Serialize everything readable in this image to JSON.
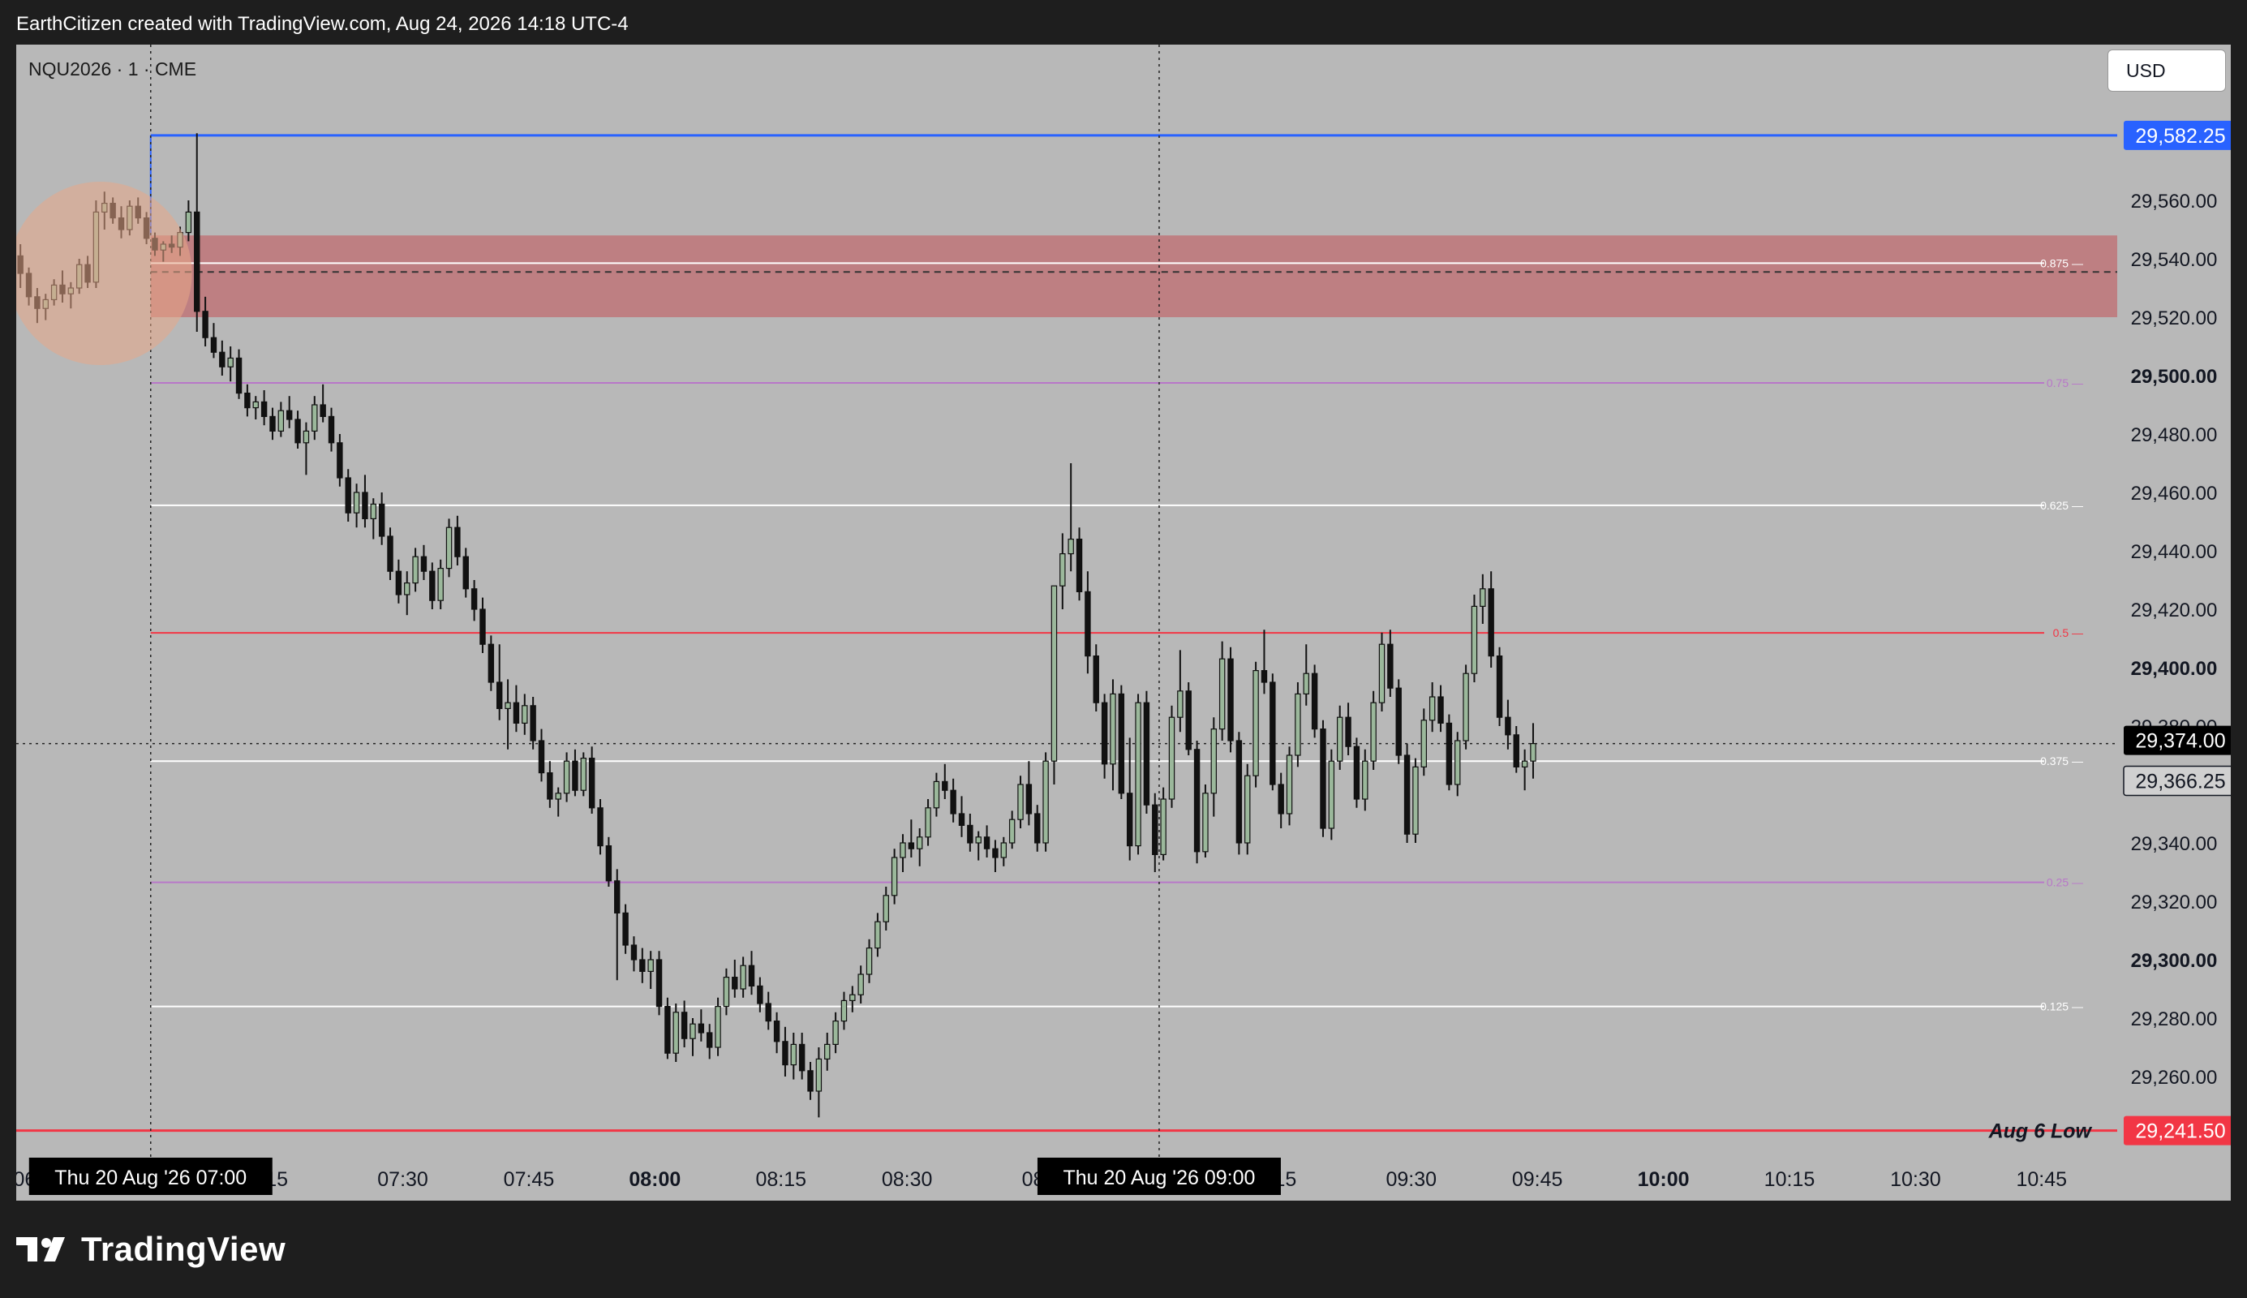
{
  "header": {
    "title": "EarthCitizen created with TradingView.com, Aug 24, 2026 14:18 UTC-4"
  },
  "symbol_label": "NQU2026 · 1 · CME",
  "currency_label": "USD",
  "footer": {
    "brand": "TradingView",
    "logo_icon": "tradingview-logo-icon"
  },
  "colors": {
    "background": "#1e1e1e",
    "plot_bg": "#b8b8b8",
    "up_candle": "#9bb89b",
    "down_candle": "#111111",
    "blue_line": "#2962ff",
    "red_line": "#f23645",
    "purple_line": "#b877c8",
    "white_line": "#ffffff",
    "zone": "#c06a6e"
  },
  "chart_data": {
    "type": "candlestick",
    "title": "NQU2026 · 1 · CME",
    "xlabel": "",
    "ylabel": "",
    "ylim": [
      29230,
      29600
    ],
    "x_range": [
      "06:44",
      "10:54"
    ],
    "yticks": [
      {
        "label": "29,560.00",
        "value": 29560,
        "bold": false
      },
      {
        "label": "29,540.00",
        "value": 29540,
        "bold": false
      },
      {
        "label": "29,520.00",
        "value": 29520,
        "bold": false
      },
      {
        "label": "29,500.00",
        "value": 29500,
        "bold": true
      },
      {
        "label": "29,480.00",
        "value": 29480,
        "bold": false
      },
      {
        "label": "29,460.00",
        "value": 29460,
        "bold": false
      },
      {
        "label": "29,440.00",
        "value": 29440,
        "bold": false
      },
      {
        "label": "29,420.00",
        "value": 29420,
        "bold": false
      },
      {
        "label": "29,400.00",
        "value": 29400,
        "bold": true
      },
      {
        "label": "29,380.00",
        "value": 29380,
        "bold": false
      },
      {
        "label": "29,360.00",
        "value": 29360,
        "bold": false
      },
      {
        "label": "29,340.00",
        "value": 29340,
        "bold": false
      },
      {
        "label": "29,320.00",
        "value": 29320,
        "bold": false
      },
      {
        "label": "29,300.00",
        "value": 29300,
        "bold": true
      },
      {
        "label": "29,280.00",
        "value": 29280,
        "bold": false
      },
      {
        "label": "29,260.00",
        "value": 29260,
        "bold": false
      }
    ],
    "xticks": [
      {
        "label": "06",
        "time": "06:45",
        "bold": false
      },
      {
        "label": "15",
        "time": "07:15",
        "bold": false
      },
      {
        "label": "07:30",
        "time": "07:30",
        "bold": false
      },
      {
        "label": "07:45",
        "time": "07:45",
        "bold": false
      },
      {
        "label": "08:00",
        "time": "08:00",
        "bold": true
      },
      {
        "label": "08:15",
        "time": "08:15",
        "bold": false
      },
      {
        "label": "08:30",
        "time": "08:30",
        "bold": false
      },
      {
        "label": "08",
        "time": "08:45",
        "bold": false
      },
      {
        "label": "15",
        "time": "09:15",
        "bold": false
      },
      {
        "label": "09:30",
        "time": "09:30",
        "bold": false
      },
      {
        "label": "09:45",
        "time": "09:45",
        "bold": false
      },
      {
        "label": "10:00",
        "time": "10:00",
        "bold": true
      },
      {
        "label": "10:15",
        "time": "10:15",
        "bold": false
      },
      {
        "label": "10:30",
        "time": "10:30",
        "bold": false
      },
      {
        "label": "10:45",
        "time": "10:45",
        "bold": false
      }
    ],
    "fib_levels": [
      {
        "label": "0.875",
        "value": 29538.5,
        "color": "#ffffff"
      },
      {
        "label": "0.75",
        "value": 29497.5,
        "color": "#b877c8"
      },
      {
        "label": "0.625",
        "value": 29455.6,
        "color": "#ffffff"
      },
      {
        "label": "0.5",
        "value": 29411.9,
        "color": "#f23645"
      },
      {
        "label": "0.375",
        "value": 29368,
        "color": "#ffffff"
      },
      {
        "label": "0.25",
        "value": 29326.5,
        "color": "#b877c8"
      },
      {
        "label": "0.125",
        "value": 29284,
        "color": "#ffffff"
      }
    ],
    "zone": {
      "top": 29548,
      "bottom": 29520,
      "mid": 29535.5,
      "start": "07:00"
    },
    "marker_circle": {
      "time": "06:54",
      "price": 29535
    },
    "horizontal_lines": [
      {
        "name": "high",
        "value": 29582.25,
        "color": "#2962ff",
        "start": "07:00"
      },
      {
        "name": "Aug 6 Low",
        "value": 29241.5,
        "color": "#f23645",
        "start": "06:44"
      }
    ],
    "line_labels": {
      "low_label": "Aug 6 Low"
    },
    "price_badges": [
      {
        "label": "29,582.25",
        "value": 29582.25,
        "style": "blue"
      },
      {
        "label": "29,374.00",
        "value": 29374,
        "style": "black"
      },
      {
        "label": "29,366.25",
        "value": 29366.25,
        "style": "outline"
      },
      {
        "label": "29,241.50",
        "value": 29241.5,
        "style": "red"
      }
    ],
    "crosshair": {
      "price": 29374
    },
    "vertical_markers": [
      {
        "time": "07:00",
        "label": "Thu 20 Aug '26   07:00"
      },
      {
        "time": "09:00",
        "label": "Thu 20 Aug '26   09:00"
      }
    ],
    "candles": [
      [
        29541,
        29545,
        29530,
        29535
      ],
      [
        29535,
        29537,
        29524,
        29527
      ],
      [
        29527,
        29530,
        29518,
        29523
      ],
      [
        29523,
        29528,
        29519,
        29526
      ],
      [
        29526,
        29533,
        29524,
        29531
      ],
      [
        29531,
        29536,
        29525,
        29528
      ],
      [
        29528,
        29532,
        29523,
        29530
      ],
      [
        29530,
        29540,
        29528,
        29538
      ],
      [
        29538,
        29541,
        29530,
        29532
      ],
      [
        29532,
        29560,
        29530,
        29556
      ],
      [
        29556,
        29563,
        29550,
        29559
      ],
      [
        29559,
        29561,
        29552,
        29554
      ],
      [
        29554,
        29558,
        29547,
        29550
      ],
      [
        29550,
        29560,
        29548,
        29558
      ],
      [
        29558,
        29561,
        29552,
        29554
      ],
      [
        29554,
        29556,
        29545,
        29547
      ],
      [
        29547,
        29549,
        29541,
        29543
      ],
      [
        29543,
        29546,
        29539,
        29545
      ],
      [
        29545,
        29548,
        29542,
        29544
      ],
      [
        29544,
        29551,
        29541,
        29549
      ],
      [
        29549,
        29560,
        29546,
        29556
      ],
      [
        29556,
        29583,
        29515,
        29522
      ],
      [
        29522,
        29527,
        29510,
        29513
      ],
      [
        29513,
        29518,
        29506,
        29508
      ],
      [
        29508,
        29512,
        29500,
        29503
      ],
      [
        29503,
        29510,
        29498,
        29506
      ],
      [
        29506,
        29509,
        29492,
        29494
      ],
      [
        29494,
        29497,
        29486,
        29489
      ],
      [
        29489,
        29493,
        29485,
        29491
      ],
      [
        29491,
        29495,
        29483,
        29486
      ],
      [
        29486,
        29489,
        29478,
        29481
      ],
      [
        29481,
        29491,
        29479,
        29488
      ],
      [
        29488,
        29493,
        29482,
        29485
      ],
      [
        29485,
        29488,
        29475,
        29477
      ],
      [
        29477,
        29484,
        29466,
        29481
      ],
      [
        29481,
        29493,
        29478,
        29490
      ],
      [
        29490,
        29497,
        29484,
        29486
      ],
      [
        29486,
        29489,
        29474,
        29477
      ],
      [
        29477,
        29480,
        29462,
        29465
      ],
      [
        29465,
        29468,
        29450,
        29453
      ],
      [
        29453,
        29463,
        29448,
        29460
      ],
      [
        29460,
        29466,
        29448,
        29451
      ],
      [
        29451,
        29458,
        29444,
        29456
      ],
      [
        29456,
        29460,
        29442,
        29445
      ],
      [
        29445,
        29448,
        29430,
        29433
      ],
      [
        29433,
        29437,
        29422,
        29425
      ],
      [
        29425,
        29433,
        29418,
        29429
      ],
      [
        29429,
        29441,
        29426,
        29438
      ],
      [
        29438,
        29442,
        29430,
        29433
      ],
      [
        29433,
        29436,
        29420,
        29423
      ],
      [
        29423,
        29437,
        29420,
        29434
      ],
      [
        29434,
        29451,
        29431,
        29448
      ],
      [
        29448,
        29452,
        29435,
        29438
      ],
      [
        29438,
        29441,
        29424,
        29427
      ],
      [
        29427,
        29430,
        29416,
        29420
      ],
      [
        29420,
        29424,
        29405,
        29408
      ],
      [
        29408,
        29411,
        29392,
        29395
      ],
      [
        29395,
        29408,
        29382,
        29386
      ],
      [
        29386,
        29396,
        29372,
        29388
      ],
      [
        29388,
        29394,
        29378,
        29381
      ],
      [
        29381,
        29391,
        29377,
        29387
      ],
      [
        29387,
        29390,
        29372,
        29375
      ],
      [
        29375,
        29379,
        29361,
        29364
      ],
      [
        29364,
        29368,
        29352,
        29355
      ],
      [
        29355,
        29359,
        29349,
        29357
      ],
      [
        29357,
        29371,
        29354,
        29368
      ],
      [
        29368,
        29372,
        29356,
        29358
      ],
      [
        29358,
        29371,
        29356,
        29369
      ],
      [
        29369,
        29373,
        29350,
        29352
      ],
      [
        29352,
        29355,
        29336,
        29339
      ],
      [
        29339,
        29342,
        29325,
        29327
      ],
      [
        29327,
        29331,
        29293,
        29316
      ],
      [
        29316,
        29319,
        29302,
        29305
      ],
      [
        29305,
        29308,
        29296,
        29300
      ],
      [
        29300,
        29304,
        29292,
        29296
      ],
      [
        29296,
        29303,
        29290,
        29300
      ],
      [
        29300,
        29303,
        29281,
        29284
      ],
      [
        29284,
        29287,
        29266,
        29268
      ],
      [
        29268,
        29285,
        29265,
        29282
      ],
      [
        29282,
        29286,
        29270,
        29273
      ],
      [
        29273,
        29280,
        29267,
        29278
      ],
      [
        29278,
        29283,
        29272,
        29275
      ],
      [
        29275,
        29278,
        29266,
        29270
      ],
      [
        29270,
        29287,
        29267,
        29284
      ],
      [
        29284,
        29297,
        29281,
        29294
      ],
      [
        29294,
        29300,
        29287,
        29290
      ],
      [
        29290,
        29301,
        29287,
        29298
      ],
      [
        29298,
        29303,
        29288,
        29291
      ],
      [
        29291,
        29294,
        29282,
        29285
      ],
      [
        29285,
        29289,
        29276,
        29279
      ],
      [
        29279,
        29282,
        29268,
        29272
      ],
      [
        29272,
        29277,
        29260,
        29264
      ],
      [
        29264,
        29275,
        29259,
        29271
      ],
      [
        29271,
        29275,
        29259,
        29262
      ],
      [
        29262,
        29265,
        29252,
        29255
      ],
      [
        29255,
        29270,
        29246,
        29266
      ],
      [
        29266,
        29275,
        29262,
        29271
      ],
      [
        29271,
        29282,
        29268,
        29279
      ],
      [
        29279,
        29289,
        29276,
        29286
      ],
      [
        29286,
        29291,
        29282,
        29288
      ],
      [
        29288,
        29298,
        29285,
        29295
      ],
      [
        29295,
        29307,
        29292,
        29304
      ],
      [
        29304,
        29316,
        29301,
        29313
      ],
      [
        29313,
        29325,
        29310,
        29322
      ],
      [
        29322,
        29338,
        29319,
        29335
      ],
      [
        29335,
        29343,
        29330,
        29340
      ],
      [
        29340,
        29348,
        29335,
        29338
      ],
      [
        29338,
        29345,
        29332,
        29342
      ],
      [
        29342,
        29355,
        29339,
        29352
      ],
      [
        29352,
        29364,
        29349,
        29361
      ],
      [
        29361,
        29367,
        29355,
        29358
      ],
      [
        29358,
        29362,
        29347,
        29350
      ],
      [
        29350,
        29356,
        29342,
        29346
      ],
      [
        29346,
        29350,
        29337,
        29340
      ],
      [
        29340,
        29344,
        29334,
        29342
      ],
      [
        29342,
        29346,
        29335,
        29338
      ],
      [
        29338,
        29341,
        29330,
        29335
      ],
      [
        29335,
        29342,
        29332,
        29340
      ],
      [
        29340,
        29351,
        29338,
        29348
      ],
      [
        29348,
        29363,
        29345,
        29360
      ],
      [
        29360,
        29368,
        29346,
        29350
      ],
      [
        29350,
        29353,
        29337,
        29340
      ],
      [
        29340,
        29371,
        29337,
        29368
      ],
      [
        29368,
        29412,
        29360,
        29428
      ],
      [
        29428,
        29446,
        29420,
        29439
      ],
      [
        29439,
        29470,
        29433,
        29444
      ],
      [
        29444,
        29448,
        29423,
        29426
      ],
      [
        29426,
        29433,
        29398,
        29404
      ],
      [
        29404,
        29408,
        29385,
        29388
      ],
      [
        29388,
        29391,
        29362,
        29367
      ],
      [
        29367,
        29396,
        29358,
        29391
      ],
      [
        29391,
        29394,
        29355,
        29357
      ],
      [
        29357,
        29376,
        29334,
        29339
      ],
      [
        29339,
        29391,
        29336,
        29388
      ],
      [
        29388,
        29392,
        29350,
        29353
      ],
      [
        29353,
        29357,
        29330,
        29336
      ],
      [
        29336,
        29359,
        29334,
        29355
      ],
      [
        29355,
        29387,
        29352,
        29383
      ],
      [
        29383,
        29406,
        29378,
        29392
      ],
      [
        29392,
        29395,
        29370,
        29372
      ],
      [
        29372,
        29375,
        29333,
        29337
      ],
      [
        29337,
        29360,
        29335,
        29357
      ],
      [
        29357,
        29383,
        29349,
        29379
      ],
      [
        29379,
        29409,
        29375,
        29403
      ],
      [
        29403,
        29407,
        29371,
        29375
      ],
      [
        29375,
        29378,
        29336,
        29340
      ],
      [
        29340,
        29367,
        29336,
        29363
      ],
      [
        29363,
        29402,
        29359,
        29399
      ],
      [
        29399,
        29413,
        29391,
        29395
      ],
      [
        29395,
        29398,
        29358,
        29360
      ],
      [
        29360,
        29364,
        29345,
        29350
      ],
      [
        29350,
        29373,
        29346,
        29370
      ],
      [
        29370,
        29395,
        29366,
        29391
      ],
      [
        29391,
        29408,
        29387,
        29398
      ],
      [
        29398,
        29401,
        29376,
        29379
      ],
      [
        29379,
        29382,
        29342,
        29345
      ],
      [
        29345,
        29372,
        29341,
        29368
      ],
      [
        29368,
        29387,
        29365,
        29383
      ],
      [
        29383,
        29388,
        29370,
        29373
      ],
      [
        29373,
        29376,
        29352,
        29355
      ],
      [
        29355,
        29372,
        29351,
        29368
      ],
      [
        29368,
        29392,
        29365,
        29388
      ],
      [
        29388,
        29412,
        29385,
        29408
      ],
      [
        29408,
        29413,
        29390,
        29393
      ],
      [
        29393,
        29396,
        29367,
        29370
      ],
      [
        29370,
        29374,
        29340,
        29343
      ],
      [
        29343,
        29369,
        29340,
        29366
      ],
      [
        29366,
        29386,
        29363,
        29382
      ],
      [
        29382,
        29395,
        29378,
        29390
      ],
      [
        29390,
        29394,
        29378,
        29381
      ],
      [
        29381,
        29384,
        29358,
        29360
      ],
      [
        29360,
        29378,
        29356,
        29375
      ],
      [
        29375,
        29401,
        29372,
        29398
      ],
      [
        29398,
        29425,
        29395,
        29421
      ],
      [
        29421,
        29432,
        29415,
        29427
      ],
      [
        29427,
        29433,
        29400,
        29404
      ],
      [
        29404,
        29407,
        29380,
        29383
      ],
      [
        29383,
        29389,
        29372,
        29377
      ],
      [
        29377,
        29380,
        29364,
        29366
      ],
      [
        29366,
        29372,
        29358,
        29368
      ],
      [
        29368,
        29381,
        29362,
        29374
      ]
    ]
  }
}
